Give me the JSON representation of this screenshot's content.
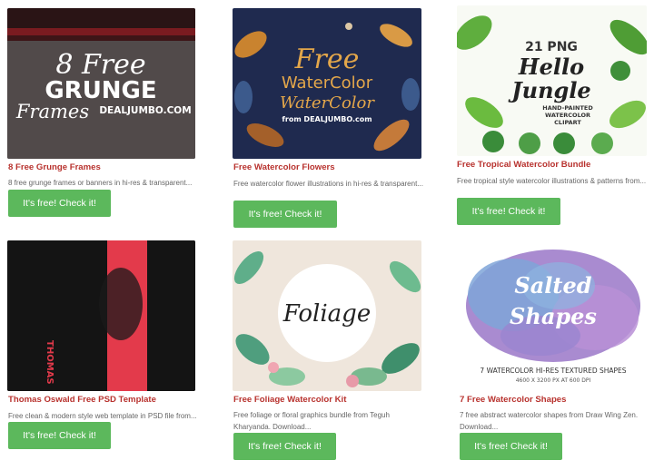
{
  "accent_colors": {
    "title": "#b8322e",
    "button": "#5cb85c"
  },
  "cards": [
    {
      "title": "8 Free Grunge Frames",
      "description": "8 free grunge frames or banners in hi-res & transparent...",
      "button": "It's free! Check it!",
      "image": {
        "line1": "8 Free",
        "line2": "GRUNGE",
        "line3": "Frames",
        "line4": "DEALJUMBO.COM"
      }
    },
    {
      "title": "Free Watercolor Flowers",
      "description": "Free watercolor flower illustrations in hi-res & transparent...",
      "button": "It's free! Check it!",
      "image": {
        "line1": "Free",
        "line2": "WaterColor",
        "line3": "WaterColor",
        "line4": "from DEALJUMBO.com"
      }
    },
    {
      "title": "Free Tropical Watercolor Bundle",
      "description": "Free tropical style watercolor illustrations & patterns from...",
      "button": "It's free! Check it!",
      "image": {
        "line1": "21 PNG",
        "line2": "Hello",
        "line3": "Jungle",
        "line4": "HAND-PAINTED",
        "line5": "WATERCOLOR",
        "line6": "CLIPART"
      }
    },
    {
      "title": "Thomas Oswald Free PSD Template",
      "description": "Free clean & modern style web template in PSD file from...",
      "button": "It's free! Check it!",
      "image": {
        "line1": "THOMAS"
      }
    },
    {
      "title": "Free Foliage Watercolor Kit",
      "description": "Free foliage or floral graphics bundle from Teguh Kharyanda. Download...",
      "button": "It's free! Check it!",
      "image": {
        "line1": "Foliage"
      }
    },
    {
      "title": "7 Free Watercolor Shapes",
      "description": "7 free abstract watercolor shapes from Draw Wing Zen. Download...",
      "button": "It's free! Check it!",
      "image": {
        "line1": "Salted",
        "line2": "Shapes",
        "line3": "7 WATERCOLOR HI-RES TEXTURED SHAPES",
        "line4": "4600 X 3200 PX  AT  600 DPI"
      }
    }
  ]
}
